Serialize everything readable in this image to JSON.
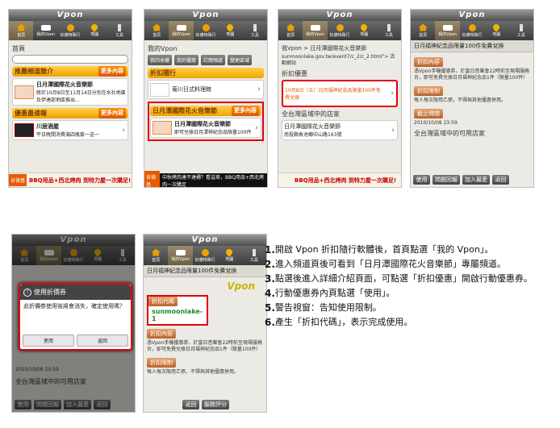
{
  "app": {
    "logo_text": "Vpon",
    "tabs": [
      "首頁",
      "我的Vpon",
      "好康特殊行",
      "地圖",
      "工具"
    ]
  },
  "screen1": {
    "header": "首頁",
    "section1_title": "推薦頻道簡介",
    "more": "更多內容",
    "item1_title": "日月潭國際花火音樂節",
    "item1_desc": "將於10月8日至11月14日分別在水社地區及伊達邵地區推出...",
    "section2_title": "優惠最速報",
    "item2_title": "川居酒屋",
    "item2_desc": "平日晚間消費滿四瓶套一送一",
    "ad_logo": "肯德基",
    "ad_text": "BBQ用品+西北烤肉 到特力屋一次購足!"
  },
  "screen2": {
    "header": "我的Vpon",
    "buttons": [
      "我的收藏",
      "我的優惠",
      "訂閱頻道",
      "變更區域"
    ],
    "section1_title": "折扣隨行",
    "item1_title": "菊川日式料理館",
    "section2_title": "日月潭國際花火音樂節",
    "more": "更多內容",
    "item2_title": "日月潭國際花火音樂節",
    "item2_desc": "即可兌換日月潭神紀念品限量100件",
    "ad_text": "中秋烤肉達不達標？看這來，BBQ用品+西北烤肉一次購足",
    "ad_logo": "肯德基"
  },
  "screen3": {
    "breadcrumb": "我Vpon > 日月潭國際花火音樂節",
    "url": "sunmoonlake.gov.tw/event7/c_2/c_2.html\"> 活動網站",
    "section_title": "折扣優惠",
    "offer_text": "10月8日（五）日月福神紀念品限量100件免費兌換",
    "section2_title": "全台灣區域中的店家",
    "store_name": "日月潭國際花火音樂節",
    "store_addr": "南投縣魚池鄉中山路163號",
    "ad_text": "BBQ用品+西北烤肉 到特力屋一次購足!"
  },
  "screen4": {
    "title": "日月福神紀念品限量100件免費兌換",
    "tag_content": "折扣內容",
    "content": "憑Vpon手機優惠券，於當日音樂會22時前至現場服務台，即可免費兌換日月福神紀念品1件（限量100件）",
    "tag_limit": "折扣限制",
    "limit": "每人每次限用乙張，不得與其他優惠併用。",
    "tag_date": "截止時間",
    "date": "2010/10/08 23:59",
    "stores": "全台灣區域中的可用店家",
    "buttons": [
      "使用",
      "問題回報",
      "加入最愛",
      "返回"
    ]
  },
  "screen5": {
    "dialog_title": "使用折價券",
    "dialog_body": "此折價券使用後將會消失，確定使用嗎？",
    "ok": "使用",
    "cancel": "返回",
    "date": "2010/10/08 23:59",
    "stores": "全台灣區域中的可用店家",
    "buttons": [
      "使用",
      "問題回報",
      "加入最愛",
      "返回"
    ]
  },
  "screen6": {
    "title": "日月福神紀念品限量100件免費兌換",
    "code_label": "折扣代碼",
    "code": "sunmoonlake-1",
    "tag_content": "折扣內容",
    "content": "憑Vpon手機優惠券，於當日音樂會22時前至現場服務台，即可免費兌換日月福神紀念品1件（限量100件）",
    "tag_limit": "折扣限制",
    "limit": "每人每次限用乙張，不得與其他優惠併用。",
    "buttons": [
      "返回",
      "服務評分"
    ]
  },
  "steps": [
    {
      "num": "1.",
      "text": "開啟 Vpon 折扣隨行軟體後，首頁點選「我的 Vpon」。"
    },
    {
      "num": "2.",
      "text": "進入頻道頁後可看到「日月潭國際花火音樂節」專屬頻道。"
    },
    {
      "num": "3.",
      "text": "點選後進入詳細介紹頁面，可點選「折扣優惠」開啟行動優惠券。"
    },
    {
      "num": "4.",
      "text": "行動優惠券內頁點選「使用」。"
    },
    {
      "num": "5.",
      "text": "警告視窗：告知使用限制。"
    },
    {
      "num": "6.",
      "text": "產生「折扣代碼」，表示完成使用。"
    }
  ]
}
